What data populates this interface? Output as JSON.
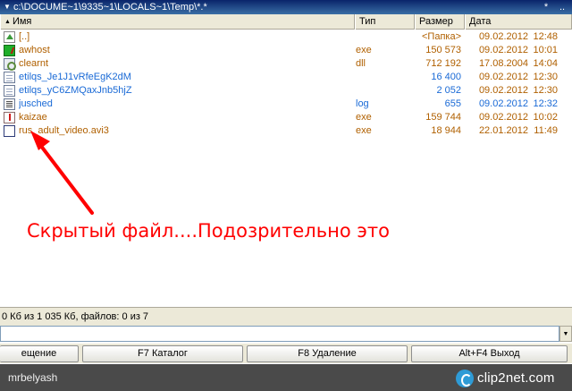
{
  "path_bar": {
    "path": "c:\\DOCUME~1\\9335~1\\LOCALS~1\\Temp\\*.*",
    "star": "*",
    "updir": "..",
    "dropdown_icon": "chevron-down-icon"
  },
  "columns": {
    "name": "Имя",
    "type": "Тип",
    "size": "Размер",
    "date": "Дата"
  },
  "files": [
    {
      "icon": "up-dir-icon",
      "name": "[..]",
      "ext": "",
      "size": "<Папка>",
      "date": "09.02.2012",
      "time": "12:48",
      "name_color": "#b06000",
      "date_color": "#b06000"
    },
    {
      "icon": "exe-icon",
      "name": "awhost",
      "ext": "exe",
      "size": "150 573",
      "date": "09.02.2012",
      "time": "10:01",
      "name_color": "#b06000",
      "date_color": "#b06000"
    },
    {
      "icon": "dll-icon",
      "name": "clearnt",
      "ext": "dll",
      "size": "712 192",
      "date": "17.08.2004",
      "time": "14:04",
      "name_color": "#b06000",
      "date_color": "#b06000"
    },
    {
      "icon": "document-icon",
      "name": "etilqs_Je1J1vRfeEgK2dM",
      "ext": "",
      "size": "16 400",
      "date": "09.02.2012",
      "time": "12:30",
      "name_color": "#1a6ad6",
      "date_color": "#b06000"
    },
    {
      "icon": "document-icon",
      "name": "etilqs_yC6ZMQaxJnb5hjZ",
      "ext": "",
      "size": "2 052",
      "date": "09.02.2012",
      "time": "12:30",
      "name_color": "#1a6ad6",
      "date_color": "#b06000"
    },
    {
      "icon": "log-icon",
      "name": "jusched",
      "ext": "log",
      "size": "655",
      "date": "09.02.2012",
      "time": "12:32",
      "name_color": "#1a6ad6",
      "date_color": "#1a6ad6"
    },
    {
      "icon": "exe-icon",
      "name": "kaizae",
      "ext": "exe",
      "size": "159 744",
      "date": "09.02.2012",
      "time": "10:02",
      "name_color": "#b06000",
      "date_color": "#b06000"
    },
    {
      "icon": "video-icon",
      "name": "rus_adult_video.avi3",
      "ext": "exe",
      "size": "18 944",
      "date": "22.01.2012",
      "time": "11:49",
      "name_color": "#b06000",
      "date_color": "#b06000"
    }
  ],
  "annotation": {
    "text": "Скрытый файл....Подозрительно это",
    "color": "#ff0000"
  },
  "status": {
    "text": "0 Кб из 1 035 Кб, файлов: 0 из 7"
  },
  "command_line": {
    "value": ""
  },
  "function_keys": [
    {
      "label": "ещение"
    },
    {
      "label": "F7 Каталог"
    },
    {
      "label": "F8 Удаление"
    },
    {
      "label": "Alt+F4 Выход"
    }
  ],
  "watermark": {
    "user": "mrbelyash",
    "logo_text": "clip2net.com"
  }
}
